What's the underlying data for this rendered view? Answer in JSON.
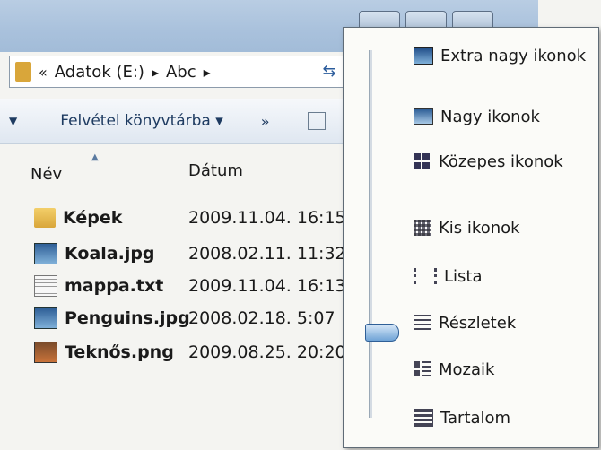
{
  "address": {
    "prefix": "«",
    "segments": [
      "Adatok (E:)",
      "Abc"
    ],
    "separator": "▸"
  },
  "toolbar": {
    "include_library_label": "Felvétel könyvtárba ▾",
    "more_label": "»"
  },
  "columns": {
    "name": "Név",
    "date": "Dátum"
  },
  "files": [
    {
      "name": "Képek",
      "date": "2009.11.04. 16:15",
      "icon": "folder-icon"
    },
    {
      "name": "Koala.jpg",
      "date": "2008.02.11. 11:32",
      "icon": "image-icon"
    },
    {
      "name": "mappa.txt",
      "date": "2009.11.04. 16:13",
      "icon": "text-file-icon"
    },
    {
      "name": "Penguins.jpg",
      "date": "2008.02.18. 5:07",
      "icon": "image-icon"
    },
    {
      "name": "Teknős.png",
      "date": "2009.08.25. 20:20",
      "icon": "image-icon"
    }
  ],
  "view_menu": {
    "items": [
      {
        "label": "Extra nagy ikonok",
        "icon": "extra-large-icons-icon"
      },
      {
        "label": "Nagy ikonok",
        "icon": "large-icons-icon"
      },
      {
        "label": "Közepes ikonok",
        "icon": "medium-icons-icon"
      },
      {
        "label": "Kis ikonok",
        "icon": "small-icons-icon"
      },
      {
        "label": "Lista",
        "icon": "list-icon"
      },
      {
        "label": "Részletek",
        "icon": "details-icon"
      },
      {
        "label": "Mozaik",
        "icon": "tiles-icon"
      },
      {
        "label": "Tartalom",
        "icon": "content-icon"
      }
    ],
    "selected": "Részletek"
  }
}
